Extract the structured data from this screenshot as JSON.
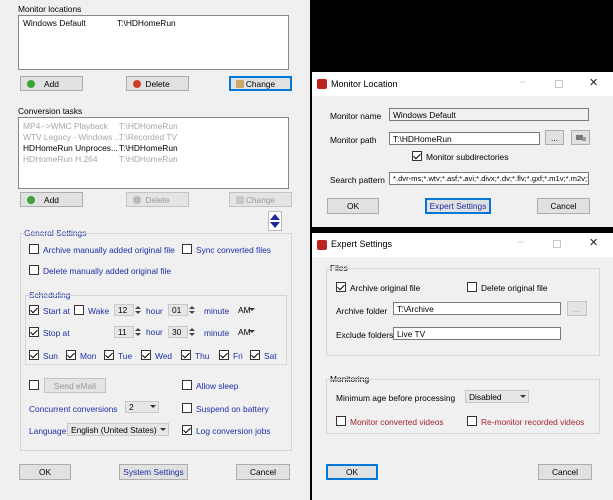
{
  "main": {
    "monitor_locations_label": "Monitor locations",
    "monitor_list": [
      {
        "name": "Windows Default",
        "path": "T:\\HDHomeRun"
      }
    ],
    "buttons": {
      "add": "Add",
      "delete": "Delete",
      "change": "Change"
    },
    "conversion_tasks_label": "Conversion tasks",
    "task_list": [
      {
        "name": "MP4-->WMC Playback",
        "path": "T:\\HDHomeRun"
      },
      {
        "name": "WTV Legacy - Windows ...",
        "path": "T:\\Recorded TV"
      },
      {
        "name": "HDHomeRun Unproces...",
        "path": "T:\\HDHomeRun"
      },
      {
        "name": "HDHomeRun H.264",
        "path": "T:\\HDHomeRun"
      }
    ],
    "task_buttons": {
      "add": "Add",
      "delete": "Delete",
      "change": "Change"
    },
    "general_settings": "General Settings",
    "archive_manual": "Archive manually added original file",
    "sync_converted": "Sync converted files",
    "delete_manual": "Delete manually added original file",
    "scheduling": "Scheduling",
    "start_at": "Start at",
    "wake": "Wake",
    "start_hour": "12",
    "start_minute": "01",
    "start_ampm": "AM",
    "stop_at": "Stop at",
    "stop_hour": "11",
    "stop_minute": "30",
    "stop_ampm": "AM",
    "hour": "hour",
    "minute": "minute",
    "days": [
      "Sun",
      "Mon",
      "Tue",
      "Wed",
      "Thu",
      "Fri",
      "Sat"
    ],
    "send_email": "Send eMail",
    "allow_sleep": "Allow sleep",
    "concurrent_conversions": "Concurrent conversions",
    "concurrent_value": "2",
    "suspend_on_battery": "Suspend on battery",
    "language": "Language",
    "language_value": "English (United States)",
    "log_conversion_jobs": "Log conversion jobs",
    "ok": "OK",
    "system_settings": "System Settings",
    "cancel": "Cancel"
  },
  "monitor_location": {
    "title": "Monitor Location",
    "monitor_name_label": "Monitor name",
    "monitor_name_value": "Windows Default",
    "monitor_path_label": "Monitor path",
    "monitor_path_value": "T:\\HDHomeRun",
    "browse": "...",
    "monitor_subdirectories": "Monitor subdirectories",
    "search_pattern_label": "Search pattern",
    "search_pattern_value": "*.dvr-ms;*.wtv;*.asf;*.avi;*.divx;*.dv;*.flv;*.gxf;*.m1v;*.m2v;*.m",
    "ok": "OK",
    "expert_settings": "Expert Settings",
    "cancel": "Cancel"
  },
  "expert": {
    "title": "Expert Settings",
    "files": "Files",
    "archive_original": "Archive original file",
    "delete_original": "Delete original file",
    "archive_folder_label": "Archive folder",
    "archive_folder_value": "T:\\Archive",
    "browse": "...",
    "exclude_folders_label": "Exclude folders",
    "exclude_folders_value": "Live TV",
    "monitoring": "Monitoring",
    "min_age_label": "Minimum age before processing",
    "min_age_value": "Disabled",
    "monitor_converted": "Monitor converted videos",
    "remonitor_recorded": "Re-monitor recorded videos",
    "ok": "OK",
    "cancel": "Cancel"
  },
  "colors": {
    "blue_label": "#1c2ea8",
    "red_label": "#a4262c",
    "accent": "#0078d7"
  }
}
